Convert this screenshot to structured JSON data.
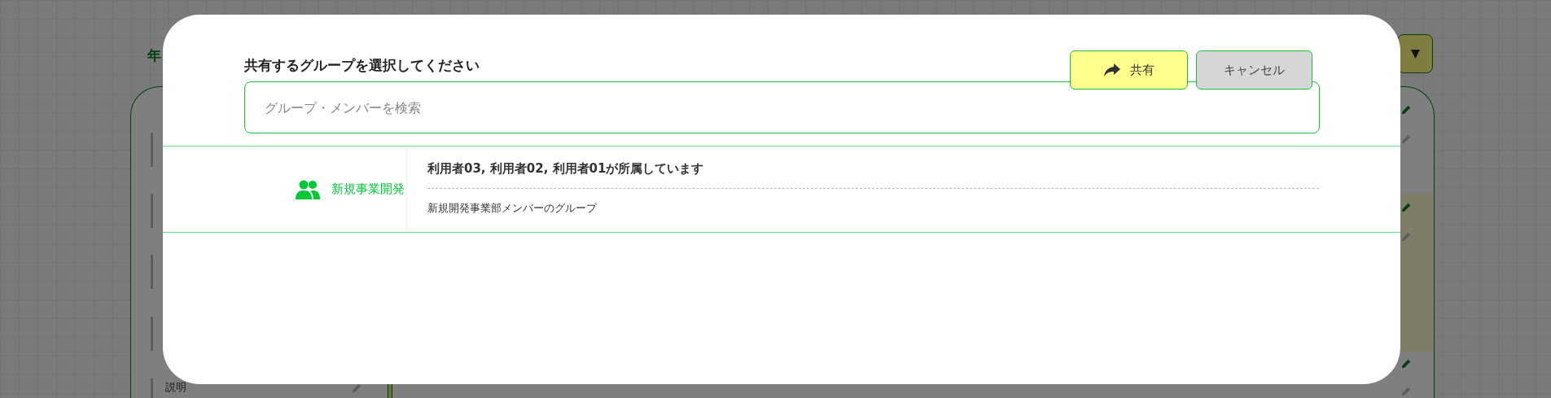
{
  "background": {
    "heading_partial": "年",
    "field_label": "説明"
  },
  "dialog": {
    "title": "共有するグループを選択してください",
    "buttons": [
      {
        "kind": "share",
        "label": "共有"
      },
      {
        "kind": "cancel",
        "label": "キャンセル"
      }
    ],
    "search": {
      "placeholder": "グループ・メンバーを検索"
    },
    "groups": [
      {
        "name": "新規事業開発",
        "members": "利用者03, 利用者02, 利用者01が所属しています",
        "description": "新規開発事業部メンバーのグループ"
      }
    ]
  }
}
